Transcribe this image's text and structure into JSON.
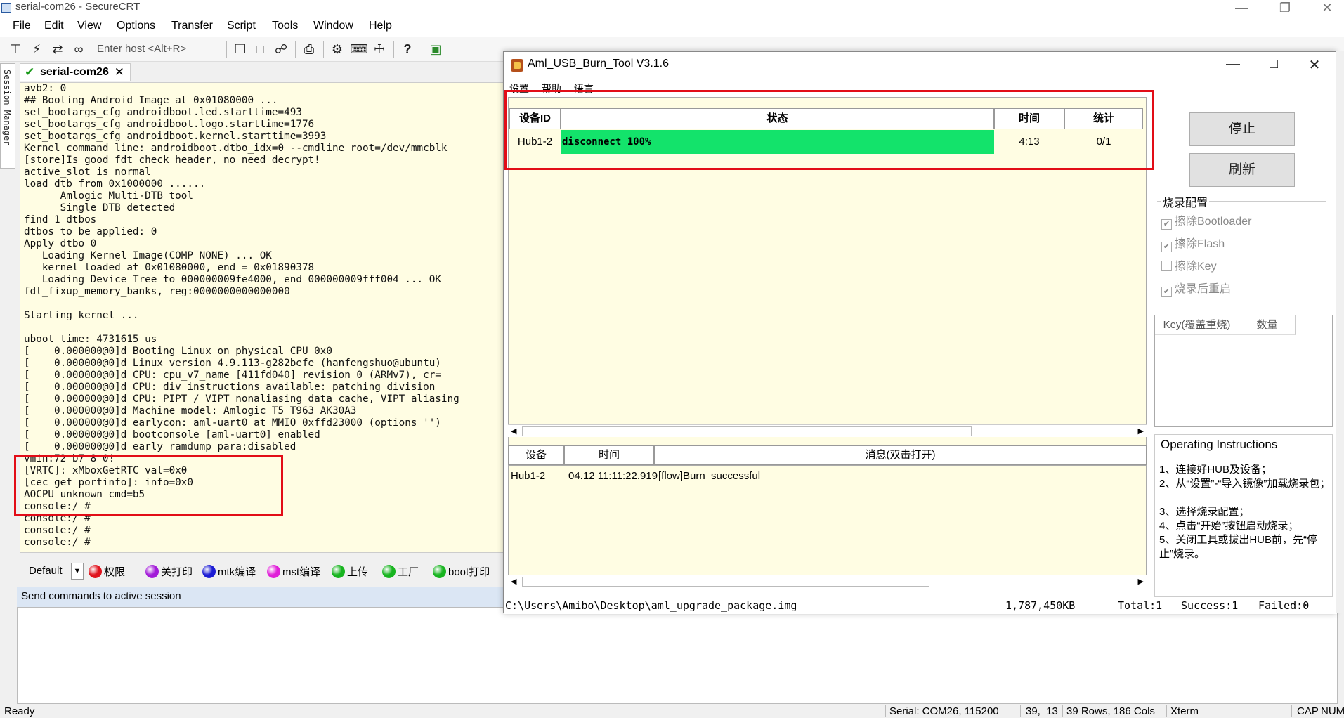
{
  "window": {
    "title": "serial-com26 - SecureCRT"
  },
  "menu": [
    "File",
    "Edit",
    "View",
    "Options",
    "Transfer",
    "Script",
    "Tools",
    "Window",
    "Help"
  ],
  "toolbar": {
    "host_placeholder": "Enter host <Alt+R>"
  },
  "session_manager": "Session Manager",
  "tab": {
    "label": "serial-com26"
  },
  "terminal": {
    "lines": [
      "avb2: 0",
      "## Booting Android Image at 0x01080000 ...",
      "set_bootargs_cfg androidboot.led.starttime=493",
      "set_bootargs_cfg androidboot.logo.starttime=1776",
      "set_bootargs_cfg androidboot.kernel.starttime=3993",
      "Kernel command line: androidboot.dtbo_idx=0 --cmdline root=/dev/mmcblk",
      "[store]Is good fdt check header, no need decrypt!",
      "active_slot is normal",
      "load dtb from 0x1000000 ......",
      "      Amlogic Multi-DTB tool",
      "      Single DTB detected",
      "find 1 dtbos",
      "dtbos to be applied: 0",
      "Apply dtbo 0",
      "   Loading Kernel Image(COMP_NONE) ... OK",
      "   kernel loaded at 0x01080000, end = 0x01890378",
      "   Loading Device Tree to 000000009fe4000, end 000000009fff004 ... OK",
      "fdt_fixup_memory_banks, reg:0000000000000000",
      "",
      "Starting kernel ...",
      "",
      "uboot time: 4731615 us",
      "[    0.000000@0]d Booting Linux on physical CPU 0x0",
      "[    0.000000@0]d Linux version 4.9.113-g282befe (hanfengshuo@ubuntu)",
      "[    0.000000@0]d CPU: cpu_v7_name [411fd040] revision 0 (ARMv7), cr=",
      "[    0.000000@0]d CPU: div instructions available: patching division",
      "[    0.000000@0]d CPU: PIPT / VIPT nonaliasing data cache, VIPT aliasing",
      "[    0.000000@0]d Machine model: Amlogic T5 T963 AK30A3",
      "[    0.000000@0]d earlycon: aml-uart0 at MMIO 0xffd23000 (options '')",
      "[    0.000000@0]d bootconsole [aml-uart0] enabled",
      "[    0.000000@0]d early_ramdump_para:disabled",
      "vmin:72 b7 8 0!",
      "[VRTC]: xMboxGetRTC val=0x0",
      "[cec_get_portinfo]: info=0x0",
      "AOCPU unknown cmd=b5",
      "console:/ #",
      "console:/ #",
      "console:/ #",
      "console:/ #"
    ]
  },
  "button_bar": {
    "default": "Default",
    "buttons": [
      {
        "label": "权限",
        "color": "#e0141e"
      },
      {
        "label": "关打印",
        "color": "#a21bd8"
      },
      {
        "label": "mtk编译",
        "color": "#1c1cd4"
      },
      {
        "label": "mst编译",
        "color": "#e020d8"
      },
      {
        "label": "上传",
        "color": "#17b41f"
      },
      {
        "label": "工厂",
        "color": "#17b41f"
      },
      {
        "label": "boot打印",
        "color": "#17b41f"
      }
    ]
  },
  "send_bar": {
    "label": "Send commands to active session"
  },
  "status": {
    "ready": "Ready",
    "serial": "Serial: COM26, 115200",
    "cursor": "39,  13",
    "dims": "39 Rows, 186 Cols",
    "term": "Xterm",
    "cap": "CAP",
    "num": "NUM"
  },
  "burn_tool": {
    "title": "Aml_USB_Burn_Tool V3.1.6",
    "menu": [
      "设置",
      "帮助",
      "语言"
    ],
    "columns": {
      "id": "设备ID",
      "state": "状态",
      "time": "时间",
      "stat": "统计"
    },
    "row": {
      "id": "Hub1-2",
      "state": "disconnect 100%",
      "time": "4:13",
      "stat": "0/1"
    },
    "buttons": {
      "stop": "停止",
      "refresh": "刷新"
    },
    "config": {
      "legend": "烧录配置",
      "items": [
        {
          "label": "擦除Bootloader",
          "checked": true
        },
        {
          "label": "擦除Flash",
          "checked": true
        },
        {
          "label": "擦除Key",
          "checked": false
        },
        {
          "label": "烧录后重启",
          "checked": true
        }
      ]
    },
    "key_table": {
      "col1": "Key(覆盖重烧)",
      "col2": "数量"
    },
    "msg_columns": {
      "device": "设备",
      "time": "时间",
      "message": "消息(双击打开)"
    },
    "msg_row": {
      "device": "Hub1-2",
      "time": "04.12 11:11:22.919",
      "message": "[flow]Burn_successful"
    },
    "instructions": {
      "title": "Operating Instructions",
      "lines": [
        "1、连接好HUB及设备；",
        "2、从“设置”-“导入镜像”加载烧录包；",
        "3、选择烧录配置；",
        "4、点击“开始”按钮启动烧录；",
        "5、关闭工具或拔出HUB前，先“停止”烧录。"
      ]
    },
    "path": "C:\\Users\\Amibo\\Desktop\\aml_upgrade_package.img",
    "size": "1,787,450KB",
    "total": "Total:1",
    "success": "Success:1",
    "failed": "Failed:0"
  }
}
